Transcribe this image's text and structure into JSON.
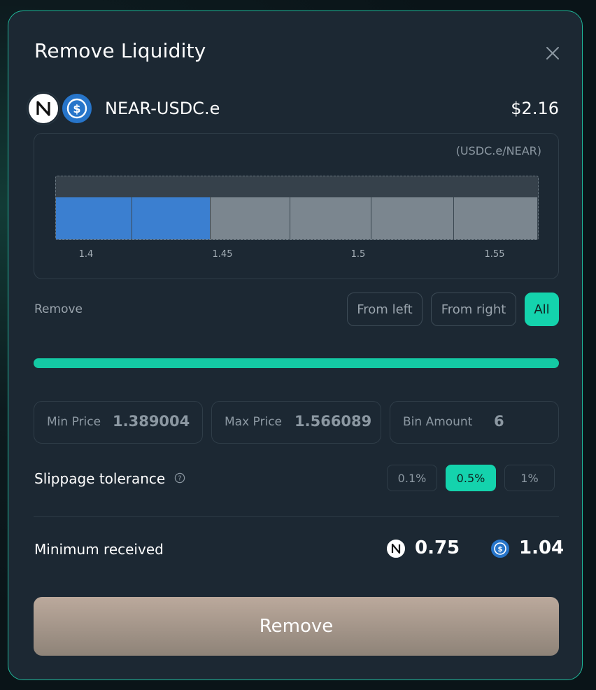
{
  "modal": {
    "title": "Remove Liquidity"
  },
  "pool": {
    "pair_name": "NEAR-USDC.e",
    "value": "$2.16",
    "icons": [
      "near-icon",
      "usdc-icon"
    ]
  },
  "range_chart": {
    "unit_label": "(USDC.e/NEAR)",
    "bins": [
      {
        "selected": true
      },
      {
        "selected": true
      },
      {
        "selected": false
      },
      {
        "selected": false
      },
      {
        "selected": false
      },
      {
        "selected": false
      }
    ],
    "ticks": [
      "1.4",
      "1.45",
      "1.5",
      "1.55"
    ],
    "colors": {
      "selected": "#3b7fd0",
      "unselected": "#7b868f"
    }
  },
  "remove_mode": {
    "label": "Remove",
    "options": [
      "From left",
      "From right",
      "All"
    ],
    "selected": "All"
  },
  "slider": {
    "percent": 100,
    "color": "#14c9a4"
  },
  "fields": {
    "min_price": {
      "label": "Min Price",
      "value": "1.389004"
    },
    "max_price": {
      "label": "Max Price",
      "value": "1.566089"
    },
    "bin_amount": {
      "label": "Bin Amount",
      "value": "6"
    }
  },
  "slippage": {
    "label": "Slippage tolerance",
    "help_icon": "question-circle-icon",
    "options": [
      "0.1%",
      "0.5%",
      "1%"
    ],
    "selected": "0.5%"
  },
  "minimum_received": {
    "label": "Minimum received",
    "near_amount": "0.75",
    "usdc_amount": "1.04"
  },
  "actions": {
    "remove_label": "Remove"
  },
  "colors": {
    "accent": "#14d3ad",
    "modal_bg": "#1c2833",
    "modal_border": "#1fb89a"
  }
}
